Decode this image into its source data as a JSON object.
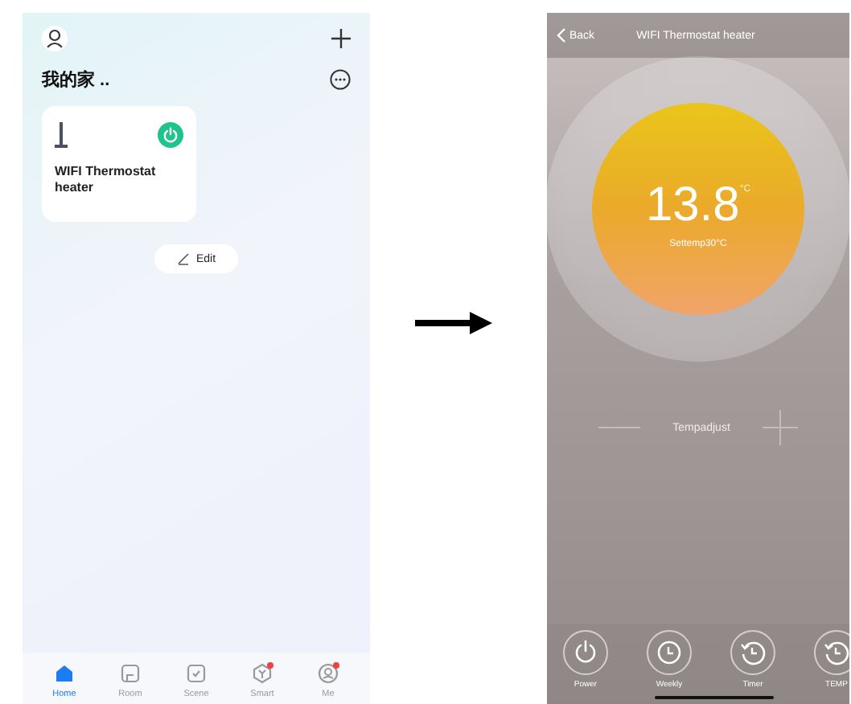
{
  "home": {
    "title": "我的家 ..",
    "devices": [
      {
        "name": "WIFI Thermostat heater",
        "on": true
      }
    ],
    "edit_button": "Edit",
    "tabs": [
      {
        "label": "Home",
        "kind": "home",
        "selected": true,
        "badge": false
      },
      {
        "label": "Room",
        "kind": "room",
        "selected": false,
        "badge": false
      },
      {
        "label": "Scene",
        "kind": "scene",
        "selected": false,
        "badge": false
      },
      {
        "label": "Smart",
        "kind": "smart",
        "selected": false,
        "badge": true
      },
      {
        "label": "Me",
        "kind": "me",
        "selected": false,
        "badge": true
      }
    ]
  },
  "detail": {
    "back": "Back",
    "title": "WIFI Thermostat heater",
    "temperature": "13.8",
    "unit": "°C",
    "set_temp": "Settemp30°C",
    "adjust_label": "Tempadjust",
    "controls": [
      {
        "label": "Power",
        "kind": "power"
      },
      {
        "label": "Weekly",
        "kind": "clock"
      },
      {
        "label": "Timer",
        "kind": "timer"
      },
      {
        "label": "TEMP",
        "kind": "timer"
      }
    ]
  }
}
